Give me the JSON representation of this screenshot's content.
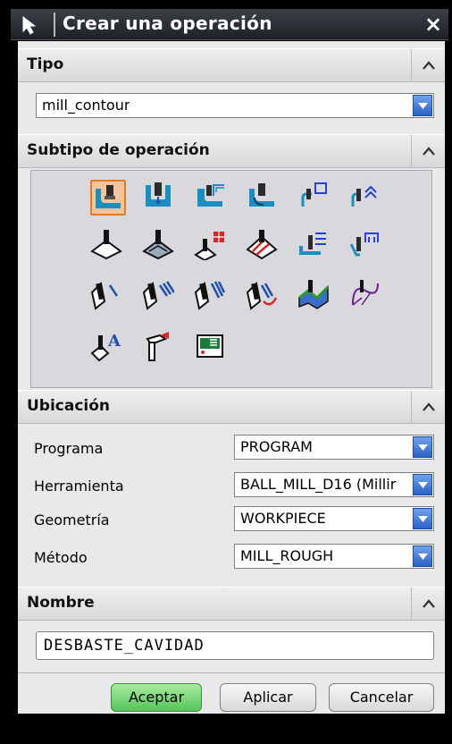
{
  "dialog": {
    "title": "Crear una operación",
    "close_glyph": "×"
  },
  "tipo": {
    "header": "Tipo",
    "value": "mill_contour"
  },
  "subtipo": {
    "header": "Subtipo de operación",
    "icons": [
      "cavity-mill-icon",
      "plunge-milling-icon",
      "corner-rough-icon",
      "rest-milling-icon",
      "zlevel-profile-icon",
      "zlevel-corner-icon",
      "fixed-contour-icon",
      "contour-area-icon",
      "contour-surface-area-icon",
      "streamline-icon",
      "contour-area-non-steep-icon",
      "contour-area-dir-steep-icon",
      "flowcut-single-icon",
      "flowcut-multiple-icon",
      "flowcut-ref-tool-icon",
      "flowcut-smooth-icon",
      "solid-profile-3d-icon",
      "contour-profile-icon",
      "contour-text-icon",
      "mill-user-icon",
      "mill-control-icon"
    ]
  },
  "ubicacion": {
    "header": "Ubicación",
    "fields": [
      {
        "label": "Programa",
        "value": "PROGRAM"
      },
      {
        "label": "Herramienta",
        "value": "BALL_MILL_D16 (Millir"
      },
      {
        "label": "Geometría",
        "value": "WORKPIECE"
      },
      {
        "label": "Método",
        "value": "MILL_ROUGH"
      }
    ]
  },
  "nombre": {
    "header": "Nombre",
    "value": "DESBASTE_CAVIDAD"
  },
  "buttons": {
    "ok": "Aceptar",
    "apply": "Aplicar",
    "cancel": "Cancelar"
  },
  "colors": {
    "selected_icon_bg": "#f6c49a",
    "combo_arrow": "#2a62c8",
    "ok_button": "#56c45a"
  }
}
